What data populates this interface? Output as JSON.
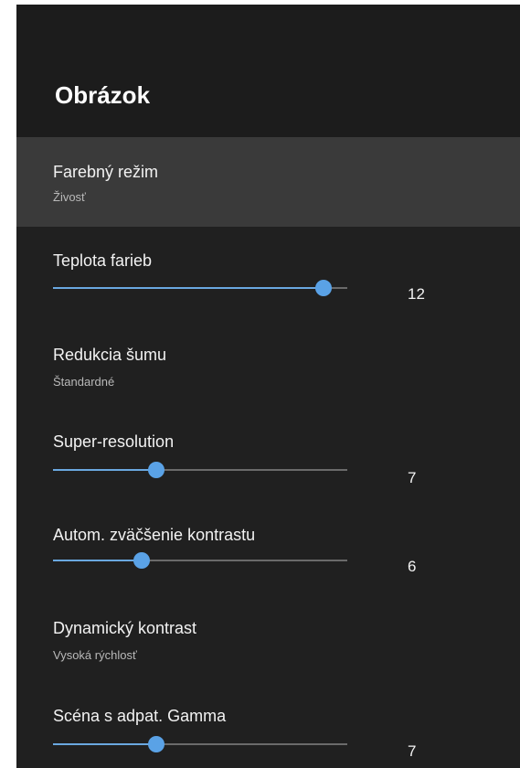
{
  "page": {
    "title": "Obrázok"
  },
  "items": [
    {
      "label": "Farebný režim",
      "sub": "Živosť",
      "selected": true
    },
    {
      "label": "Teplota farieb",
      "value": "12",
      "level": 0.92
    },
    {
      "label": "Redukcia šumu",
      "sub": "Štandardné"
    },
    {
      "label": "Super-resolution",
      "value": "7",
      "level": 0.35
    },
    {
      "label": "Autom. zväčšenie kontrastu",
      "value": "6",
      "level": 0.3
    },
    {
      "label": "Dynamický kontrast",
      "sub": "Vysoká rýchlosť"
    },
    {
      "label": "Scéna s adpat. Gamma",
      "value": "7",
      "level": 0.35
    }
  ],
  "colors": {
    "accent": "#5aa2e6",
    "panel": "#202020",
    "selected": "#3a3a3a"
  }
}
